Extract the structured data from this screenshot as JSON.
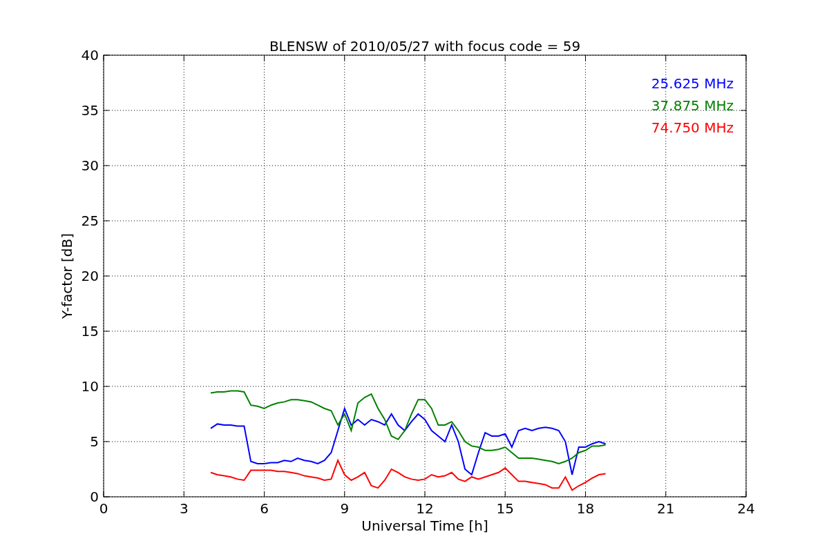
{
  "chart_data": {
    "type": "line",
    "title": "BLENSW of 2010/05/27 with focus code = 59",
    "xlabel": "Universal Time [h]",
    "ylabel": "Y-factor [dB]",
    "x": [
      4,
      4.25,
      4.5,
      4.75,
      5,
      5.25,
      5.5,
      5.75,
      6,
      6.25,
      6.5,
      6.75,
      7,
      7.25,
      7.5,
      7.75,
      8,
      8.25,
      8.5,
      8.75,
      9,
      9.25,
      9.5,
      9.75,
      10,
      10.25,
      10.5,
      10.75,
      11,
      11.25,
      11.5,
      11.75,
      12,
      12.25,
      12.5,
      12.75,
      13,
      13.25,
      13.5,
      13.75,
      14,
      14.25,
      14.5,
      14.75,
      15,
      15.25,
      15.5,
      15.75,
      16,
      16.25,
      16.5,
      16.75,
      17,
      17.25,
      17.5,
      17.75,
      18,
      18.25,
      18.5,
      18.75
    ],
    "series": [
      {
        "name": "25.625 MHz",
        "color": "#0000ff",
        "values": [
          6.2,
          6.6,
          6.5,
          6.5,
          6.4,
          6.4,
          3.2,
          3.0,
          3.0,
          3.1,
          3.1,
          3.3,
          3.2,
          3.5,
          3.3,
          3.2,
          3.0,
          3.3,
          4.0,
          6.0,
          8.0,
          6.5,
          7.0,
          6.5,
          7.0,
          6.8,
          6.5,
          7.5,
          6.5,
          6.0,
          6.8,
          7.5,
          7.0,
          6.0,
          5.5,
          5.0,
          6.5,
          5.0,
          2.5,
          2.0,
          4.0,
          5.8,
          5.5,
          5.5,
          5.7,
          4.5,
          6.0,
          6.2,
          6.0,
          6.2,
          6.3,
          6.2,
          6.0,
          5.0,
          2.0,
          4.5,
          4.5,
          4.8,
          5.0,
          4.8
        ]
      },
      {
        "name": "37.875 MHz",
        "color": "#008000",
        "values": [
          9.4,
          9.5,
          9.5,
          9.6,
          9.6,
          9.5,
          8.3,
          8.2,
          8.0,
          8.3,
          8.5,
          8.6,
          8.8,
          8.8,
          8.7,
          8.6,
          8.3,
          8.0,
          7.8,
          6.5,
          7.5,
          6.0,
          8.5,
          9.0,
          9.3,
          8.0,
          7.0,
          5.5,
          5.2,
          6.0,
          7.5,
          8.8,
          8.8,
          8.0,
          6.5,
          6.5,
          6.8,
          6.0,
          5.0,
          4.6,
          4.5,
          4.2,
          4.2,
          4.3,
          4.5,
          4.0,
          3.5,
          3.5,
          3.5,
          3.4,
          3.3,
          3.2,
          3.0,
          3.2,
          3.5,
          4.0,
          4.2,
          4.6,
          4.6,
          4.7
        ]
      },
      {
        "name": "74.750 MHz",
        "color": "#ff0000",
        "values": [
          2.2,
          2.0,
          1.9,
          1.8,
          1.6,
          1.5,
          2.4,
          2.4,
          2.4,
          2.4,
          2.3,
          2.3,
          2.2,
          2.1,
          1.9,
          1.8,
          1.7,
          1.5,
          1.6,
          3.3,
          2.0,
          1.5,
          1.8,
          2.2,
          1.0,
          0.8,
          1.5,
          2.5,
          2.2,
          1.8,
          1.6,
          1.5,
          1.6,
          2.0,
          1.8,
          1.9,
          2.2,
          1.6,
          1.4,
          1.8,
          1.6,
          1.8,
          2.0,
          2.2,
          2.6,
          2.0,
          1.4,
          1.4,
          1.3,
          1.2,
          1.1,
          0.8,
          0.8,
          1.8,
          0.6,
          1.0,
          1.3,
          1.7,
          2.0,
          2.1
        ]
      }
    ],
    "grid": true,
    "xlim": [
      0,
      24
    ],
    "ylim": [
      0,
      40
    ],
    "xticks": [
      0,
      3,
      6,
      9,
      12,
      15,
      18,
      21,
      24
    ],
    "yticks": [
      0,
      5,
      10,
      15,
      20,
      25,
      30,
      35,
      40
    ]
  }
}
